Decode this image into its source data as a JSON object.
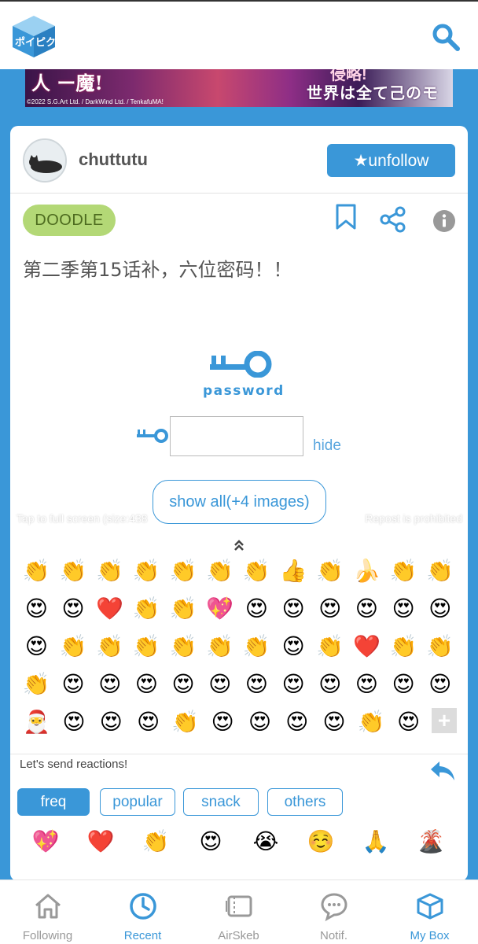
{
  "header": {
    "logo_text": "ポイピク"
  },
  "banner": {
    "left_text": "人 ー魔!",
    "top_text": "侵略!",
    "right_text": "世界は全て己のモノ!",
    "copyright": "©2022 S.G.Art Ltd. / DarkWind Ltd. / TenkafuMA!"
  },
  "post": {
    "username": "chuttutu",
    "unfollow_label": "★unfollow",
    "category": "DOODLE",
    "title": "第二季第15话补，六位密码！！",
    "password_label": "password",
    "password_value": "",
    "hide_label": "hide",
    "show_all_label": "show all(+4 images)",
    "tap_label": "Tap to full screen (size:438",
    "repost_label": "Repost is prohibited"
  },
  "reactions": {
    "rows": [
      [
        "👏",
        "👏",
        "👏",
        "👏",
        "👏",
        "👏",
        "👏",
        "👍",
        "👏",
        "🍌",
        "👏",
        "👏"
      ],
      [
        "😍",
        "😍",
        "❤️",
        "👏",
        "👏",
        "💖",
        "😍",
        "😍",
        "😍",
        "😍",
        "😍",
        "😍"
      ],
      [
        "😍",
        "👏",
        "👏",
        "👏",
        "👏",
        "👏",
        "👏",
        "😍",
        "👏",
        "❤️",
        "👏",
        "👏"
      ],
      [
        "👏",
        "😍",
        "😍",
        "😍",
        "😍",
        "😍",
        "😍",
        "😍",
        "😍",
        "😍",
        "😍",
        "😍"
      ],
      [
        "🎅",
        "😍",
        "😍",
        "😍",
        "👏",
        "😍",
        "😍",
        "😍",
        "😍",
        "👏",
        "😍"
      ]
    ],
    "add_label": "+",
    "send_prompt": "Let's send reactions!",
    "tabs": [
      {
        "label": "freq",
        "active": true
      },
      {
        "label": "popular",
        "active": false
      },
      {
        "label": "snack",
        "active": false
      },
      {
        "label": "others",
        "active": false
      }
    ],
    "freq_emojis": [
      "💖",
      "❤️",
      "👏",
      "😍",
      "😭",
      "☺️",
      "🙏",
      "🌋"
    ]
  },
  "bottom_nav": {
    "items": [
      {
        "label": "Following",
        "icon": "home-icon",
        "active": false
      },
      {
        "label": "Recent",
        "icon": "clock-icon",
        "active": true
      },
      {
        "label": "AirSkeb",
        "icon": "ticket-icon",
        "active": false
      },
      {
        "label": "Notif.",
        "icon": "chat-icon",
        "active": false
      },
      {
        "label": "My Box",
        "icon": "box-icon",
        "active": true
      }
    ]
  },
  "colors": {
    "accent": "#3a97d8",
    "tag_bg": "#b3d876",
    "tag_text": "#4c6a1e",
    "muted": "#999999"
  }
}
